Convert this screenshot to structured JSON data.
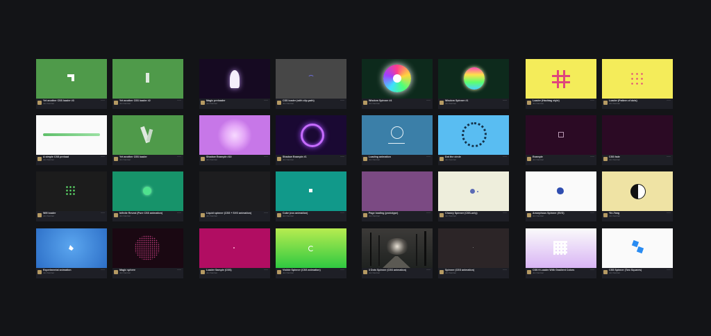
{
  "author": "Jon Kantner",
  "more_icon": "more-horizontal-icon",
  "avatar_icon": "user-avatar",
  "cards": [
    {
      "title": "Yet another CSS loader #3"
    },
    {
      "title": "Yet another CSS loader #2"
    },
    {
      "title": "Magic preloader"
    },
    {
      "title": "CSS loader (with clip-path)"
    },
    {
      "title": "Wisdom Spinner #4"
    },
    {
      "title": "Wisdom Spinner #1"
    },
    {
      "title": "Loader (Hashtag style)"
    },
    {
      "title": "Loader (Pattern of dots)"
    },
    {
      "title": "A simple CSS preload"
    },
    {
      "title": "Yet another CSS loader"
    },
    {
      "title": "Shadow Example #10"
    },
    {
      "title": "Shadow Example #1"
    },
    {
      "title": "Loading animation"
    },
    {
      "title": "Dot the circle"
    },
    {
      "title": "Example"
    },
    {
      "title": "CSS fade"
    },
    {
      "title": "Wifi loader"
    },
    {
      "title": "Infinite Reveal (Pure CSS animation)"
    },
    {
      "title": "Liquid spinner (CSS + SVG animation)"
    },
    {
      "title": "Cube (css animation)"
    },
    {
      "title": "Page loading (prototype)"
    },
    {
      "title": "Chasey Spinner (CSS-only)"
    },
    {
      "title": "Amorphous Spinner (SVG)"
    },
    {
      "title": "Yin-Yang"
    },
    {
      "title": "Experimental animation"
    },
    {
      "title": "Magic sphere"
    },
    {
      "title": "Loader Sample (CSS)"
    },
    {
      "title": "Visible Spinner (CSS animation)"
    },
    {
      "title": "3 Dots Spinner (CSS animation)"
    },
    {
      "title": "Spinner (CSS animation)"
    },
    {
      "title": "CSS 9 Loader With Gradient Colors"
    },
    {
      "title": "CSS Spinner (Two Squares)"
    }
  ]
}
